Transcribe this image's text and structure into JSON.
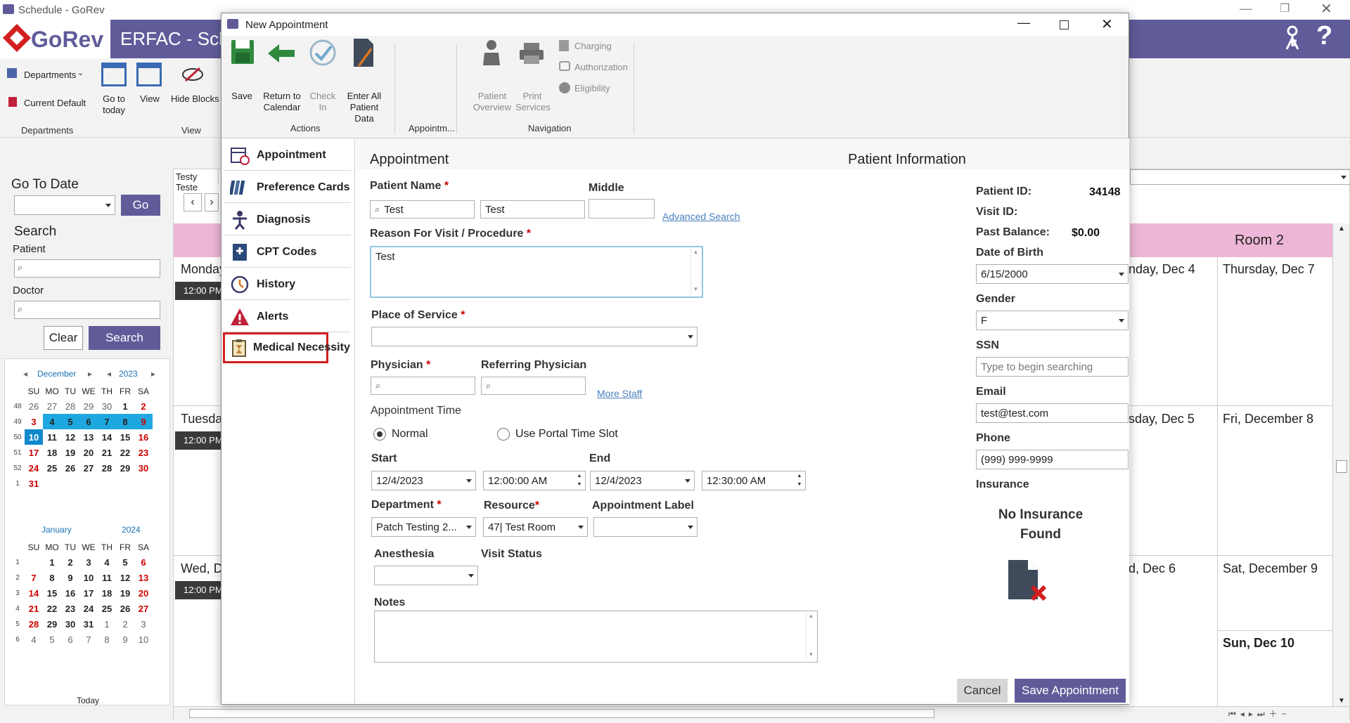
{
  "app": {
    "window_title": "Schedule - GoRev",
    "logo_text": "GoRev",
    "header_title": "ERFAC - Sche",
    "ribbon": {
      "departments_label": "Departments",
      "current_default": "Current Default",
      "departments_group": "Departments",
      "go_today": "Go to today",
      "view": "View",
      "hide_blocks": "Hide Blocks",
      "view_group": "View"
    },
    "sidebar": {
      "go_to_date": "Go To Date",
      "go": "Go",
      "search": "Search",
      "patient": "Patient",
      "doctor": "Doctor",
      "clear": "Clear",
      "search_btn": "Search",
      "today": "Today"
    },
    "calendar_dec": {
      "month": "December",
      "year": "2023",
      "headers": [
        "SU",
        "MO",
        "TU",
        "WE",
        "TH",
        "FR",
        "SA"
      ],
      "weeks": [
        "48",
        "49",
        "50",
        "51",
        "52",
        "1"
      ],
      "rows": [
        [
          "26",
          "27",
          "28",
          "29",
          "30",
          "1",
          "2"
        ],
        [
          "3",
          "4",
          "5",
          "6",
          "7",
          "8",
          "9"
        ],
        [
          "10",
          "11",
          "12",
          "13",
          "14",
          "15",
          "16"
        ],
        [
          "17",
          "18",
          "19",
          "20",
          "21",
          "22",
          "23"
        ],
        [
          "24",
          "25",
          "26",
          "27",
          "28",
          "29",
          "30"
        ],
        [
          "31",
          "",
          "",
          "",
          "",
          "",
          ""
        ]
      ]
    },
    "calendar_jan": {
      "month": "January",
      "year": "2024",
      "headers": [
        "SU",
        "MO",
        "TU",
        "WE",
        "TH",
        "FR",
        "SA"
      ],
      "weeks": [
        "1",
        "2",
        "3",
        "4",
        "5",
        "6"
      ],
      "rows": [
        [
          "",
          "1",
          "2",
          "3",
          "4",
          "5",
          "6"
        ],
        [
          "7",
          "8",
          "9",
          "10",
          "11",
          "12",
          "13"
        ],
        [
          "14",
          "15",
          "16",
          "17",
          "18",
          "19",
          "20"
        ],
        [
          "21",
          "22",
          "23",
          "24",
          "25",
          "26",
          "27"
        ],
        [
          "28",
          "29",
          "30",
          "31",
          "1",
          "2",
          "3"
        ],
        [
          "4",
          "5",
          "6",
          "7",
          "8",
          "9",
          "10"
        ]
      ]
    },
    "schedule": {
      "provider_tab": "Testy Teste",
      "room2": "Room 2",
      "day_monday": "Monday",
      "day_tuesday": "Tuesda",
      "day_wed": "Wed, D",
      "time": "12:00 PM",
      "c1": "nday, Dec 4",
      "c2": "Thursday, Dec 7",
      "c3": "sday, Dec 5",
      "c4": "Fri, December 8",
      "c5": "d, Dec 6",
      "c6": "Sat, December 9",
      "c7": "Sun, Dec 10"
    }
  },
  "dialog": {
    "title": "New Appointment",
    "ribbon": {
      "save": "Save",
      "return1": "Return to",
      "return2": "Calendar",
      "check1": "Check",
      "check2": "In",
      "enter1": "Enter All",
      "enter2": "Patient Data",
      "actions": "Actions",
      "appointm": "Appointm...",
      "patient_overview1": "Patient",
      "patient_overview2": "Overview",
      "print1": "Print",
      "print2": "Services",
      "charging": "Charging",
      "authorization": "Authorization",
      "eligibility": "Eligibility",
      "navigation": "Navigation"
    },
    "nav": [
      "Appointment",
      "Preference Cards",
      "Diagnosis",
      "CPT Codes",
      "History",
      "Alerts",
      "Medical Necessity"
    ],
    "form": {
      "heading": "Appointment",
      "patient_name": "Patient Name",
      "middle": "Middle",
      "first": "Test",
      "last": "Test",
      "advanced_search": "Advanced Search",
      "reason": "Reason For Visit / Procedure",
      "reason_value": "Test",
      "place_of_service": "Place of Service",
      "physician": "Physician",
      "referring_physician": "Referring Physician",
      "more_staff": "More Staff",
      "appointment_time": "Appointment Time",
      "normal": "Normal",
      "portal": "Use Portal Time Slot",
      "start": "Start",
      "end": "End",
      "start_date": "12/4/2023",
      "start_time": "12:00:00 AM",
      "end_date": "12/4/2023",
      "end_time": "12:30:00 AM",
      "department": "Department",
      "department_value": "Patch Testing 2...",
      "resource": "Resource",
      "resource_value": "47| Test Room",
      "appointment_label": "Appointment Label",
      "anesthesia": "Anesthesia",
      "visit_status": "Visit Status",
      "notes": "Notes",
      "cancel": "Cancel",
      "save_appointment": "Save Appointment"
    },
    "patient_info": {
      "heading": "Patient Information",
      "patient_id_label": "Patient ID:",
      "patient_id": "34148",
      "visit_id_label": "Visit ID:",
      "past_balance_label": "Past Balance:",
      "past_balance": "$0.00",
      "dob_label": "Date of Birth",
      "dob": "6/15/2000",
      "gender_label": "Gender",
      "gender": "F",
      "ssn_label": "SSN",
      "ssn_placeholder": "Type to begin searching",
      "email_label": "Email",
      "email": "test@test.com",
      "phone_label": "Phone",
      "phone": "(999) 999-9999",
      "insurance_label": "Insurance",
      "no_insurance": "No Insurance Found"
    }
  },
  "colors": {
    "brand": "#605c9a",
    "accent_red": "#d21f1f",
    "calendar_highlight": "#1fa8e0",
    "room_header": "#eeb6d6",
    "time_block": "#3a3a3a"
  }
}
